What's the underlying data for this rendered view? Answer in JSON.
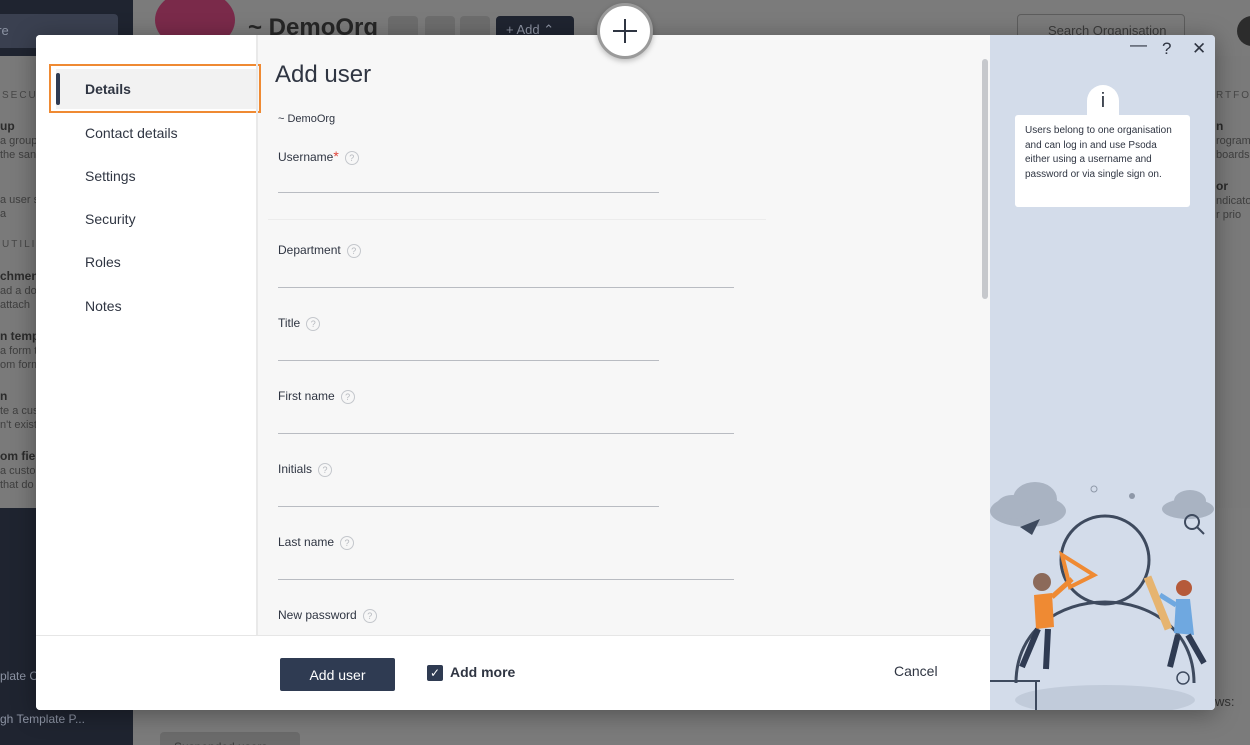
{
  "background": {
    "sidebar_search": "ere",
    "org_title": "~ DemoOrg",
    "add_button": "Add",
    "search_org_placeholder": "Search Organisation",
    "left_panel": {
      "section1": "SECUR",
      "item1_title": "up",
      "item1_line1": "a group",
      "item1_line2": "the san",
      "item2_line1": "a user s",
      "item2_line2": "a",
      "section2": "UTILIT",
      "item3_title": "chmen",
      "item3_line1": "ad a do",
      "item3_line2": "attach",
      "item4_title": "n temp",
      "item4_line1": "a form t",
      "item4_line2": "om form",
      "item5_title": "n",
      "item5_line1": "te a cus",
      "item5_line2": "n't exist",
      "item6_title": "om fie",
      "item6_line1": "a custo",
      "item6_line2": "that do"
    },
    "right_panel": {
      "section": "RTFOLI",
      "item1_title": "n",
      "item1_line1": "rogram",
      "item1_line2": "boards",
      "item2_title": "or",
      "item2_line1": "ndicato",
      "item2_line2": "r prio"
    },
    "bottom_items": [
      "plate C",
      "gh Template P..."
    ],
    "bottom_button": "Suspended users",
    "ws_label": "ws:"
  },
  "nav": {
    "items": [
      {
        "label": "Details"
      },
      {
        "label": "Contact details"
      },
      {
        "label": "Settings"
      },
      {
        "label": "Security"
      },
      {
        "label": "Roles"
      },
      {
        "label": "Notes"
      }
    ]
  },
  "form": {
    "title": "Add user",
    "org": "~ DemoOrg",
    "help_glyph": "?",
    "required_mark": "*",
    "fields": [
      {
        "label": "Username",
        "value": ""
      },
      {
        "label": "Department",
        "value": ""
      },
      {
        "label": "Title",
        "value": ""
      },
      {
        "label": "First name",
        "value": ""
      },
      {
        "label": "Initials",
        "value": ""
      },
      {
        "label": "Last name",
        "value": ""
      },
      {
        "label": "New password",
        "value": ""
      }
    ]
  },
  "footer": {
    "add_user_label": "Add user",
    "add_more_label": "Add more",
    "add_more_checked": true,
    "cancel_label": "Cancel"
  },
  "info": {
    "minimize": "—",
    "help": "?",
    "close": "✕",
    "icon_letter": "i",
    "text": "Users belong to one organisation and can log in and use Psoda either using a username and password or via single sign on."
  },
  "colors": {
    "primary": "#2f3b52",
    "highlight": "#ef8a33",
    "info_bg": "#d3dcea",
    "required": "#e0443a"
  }
}
